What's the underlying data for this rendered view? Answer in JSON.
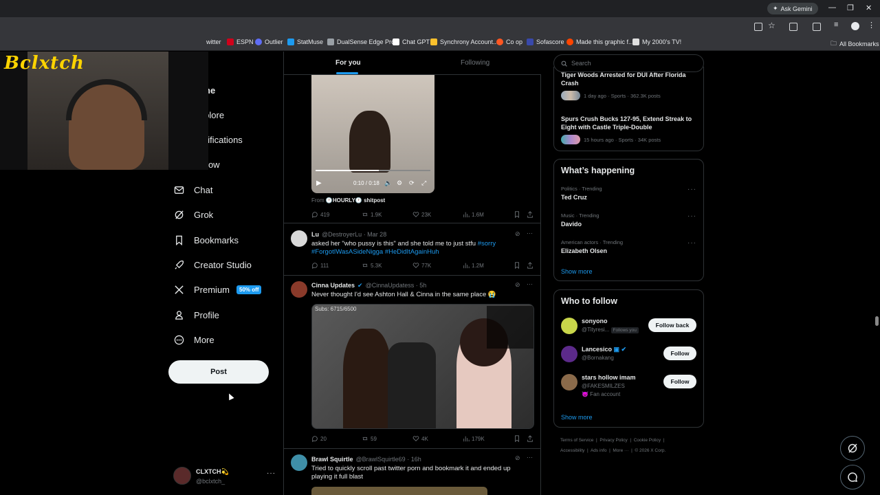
{
  "browser": {
    "gemini_label": "Ask Gemini",
    "bookmarks": [
      {
        "label": "witter",
        "color": "#1d9bf0"
      },
      {
        "label": "ESPN",
        "color": "#d0021b"
      },
      {
        "label": "Outlier",
        "color": "#5f6df5"
      },
      {
        "label": "StatMuse",
        "color": "#1d9bf0"
      },
      {
        "label": "DualSense Edge Pro...",
        "color": "#9aa0a6"
      },
      {
        "label": "Chat GPT",
        "color": "#ffffff"
      },
      {
        "label": "Synchrony Account...",
        "color": "#fbc02d"
      },
      {
        "label": "Co op",
        "color": "#ff5722"
      },
      {
        "label": "Sofascore",
        "color": "#3949ab"
      },
      {
        "label": "Made this graphic f...",
        "color": "#ff4500"
      },
      {
        "label": "My 2000's TV!",
        "color": "#e0e0e0"
      }
    ],
    "all_bookmarks": "All Bookmarks"
  },
  "overlay": {
    "logo_text": "Bclxtch"
  },
  "nav": {
    "home_partial": "ne",
    "items": [
      {
        "label": "Explore",
        "icon": "search-icon"
      },
      {
        "label": "Notifications",
        "icon": "bell-icon"
      },
      {
        "label": "Follow",
        "icon": "person-plus-icon"
      },
      {
        "label": "Chat",
        "icon": "mail-icon"
      },
      {
        "label": "Grok",
        "icon": "grok-icon"
      },
      {
        "label": "Bookmarks",
        "icon": "bookmark-icon"
      },
      {
        "label": "Creator Studio",
        "icon": "rocket-icon"
      },
      {
        "label": "Premium",
        "icon": "x-logo-icon"
      },
      {
        "label": "Profile",
        "icon": "person-icon"
      },
      {
        "label": "More",
        "icon": "more-circle-icon"
      }
    ],
    "premium_badge": "50% off",
    "post_button": "Post",
    "account": {
      "name": "CLXTCH💫",
      "handle": "@bclxtch_"
    }
  },
  "feed": {
    "tabs": [
      {
        "label": "For you"
      },
      {
        "label": "Following"
      }
    ],
    "post1": {
      "video_time": "0:10 / 0:18",
      "from_label": "From",
      "from_name": "🕐HOURLY🕐 shitpost",
      "replies": "419",
      "reposts": "1.9K",
      "likes": "23K",
      "views": "1.6M"
    },
    "post2": {
      "name": "Lu",
      "handle": "@DestroyerLu",
      "time": "· Mar 28",
      "text": "asked her \"who pussy is this\" and she told me to just stfu",
      "tags1": "#sorry",
      "tags2": "#ForgotIWasASideNigga #HeDidItAgainHuh",
      "replies": "111",
      "reposts": "5.3K",
      "likes": "77K",
      "views": "1.2M"
    },
    "post3": {
      "name": "Cinna Updates",
      "handle": "@CinnaUpdatess",
      "time": "· 5h",
      "text": "Never thought I'd see Ashton Hall & Cinna in the same place 😭",
      "subs": "Subs: 6715/6500",
      "replies": "20",
      "reposts": "59",
      "likes": "4K",
      "views": "179K"
    },
    "post4": {
      "name": "Brawl Squirtle",
      "handle": "@BrawlSquirtle69",
      "time": "· 16h",
      "text": "Tried to quickly scroll past twitter porn and bookmark it and ended up playing it full blast"
    }
  },
  "sidebar": {
    "search_placeholder": "Search",
    "news": [
      {
        "title": "Tiger Woods Arrested for DUI After Florida Crash",
        "meta": "1 day ago · Sports · 362.3K posts"
      },
      {
        "title": "Spurs Crush Bucks 127-95, Extend Streak to Eight with Castle Triple-Double",
        "meta": "15 hours ago · Sports · 34K posts"
      }
    ],
    "happening_title": "What’s happening",
    "trends": [
      {
        "meta": "Politics · Trending",
        "name": "Ted Cruz"
      },
      {
        "meta": "Music · Trending",
        "name": "Davido"
      },
      {
        "meta": "American actors · Trending",
        "name": "Elizabeth Olsen"
      }
    ],
    "show_more": "Show more",
    "wtf_title": "Who to follow",
    "who_to_follow": [
      {
        "name": "sonyono",
        "handle": "@Tityresi...",
        "follows_you": "Follows you",
        "button": "Follow back",
        "avatar_color": "#c9d64a"
      },
      {
        "name": "Lancesico",
        "handle": "@Bornakang",
        "button": "Follow",
        "avatar_color": "#5c2a8a"
      },
      {
        "name": "stars hollow imam",
        "handle": "@FAKESMILZES",
        "sub": "😈 Fan account",
        "button": "Follow",
        "avatar_color": "#8a6a4a"
      }
    ],
    "footer": {
      "line1": [
        "Terms of Service",
        "Privacy Policy",
        "Cookie Policy"
      ],
      "line2": [
        "Accessibility",
        "Ads info",
        "More ···",
        "© 2026 X Corp."
      ]
    }
  }
}
